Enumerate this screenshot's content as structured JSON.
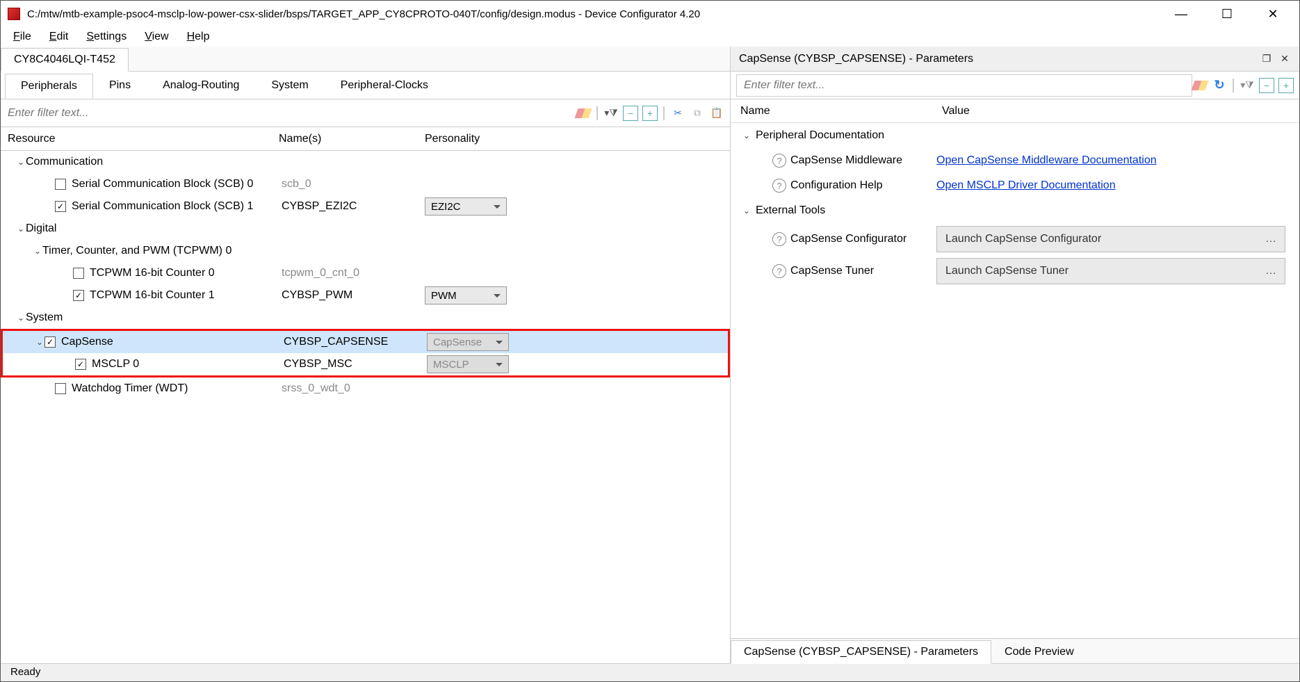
{
  "window": {
    "title": "C:/mtw/mtb-example-psoc4-msclp-low-power-csx-slider/bsps/TARGET_APP_CY8CPROTO-040T/config/design.modus - Device Configurator 4.20"
  },
  "menu": {
    "file": "File",
    "edit": "Edit",
    "settings": "Settings",
    "view": "View",
    "help": "Help"
  },
  "deviceTab": "CY8C4046LQI-T452",
  "subtabs": {
    "peripherals": "Peripherals",
    "pins": "Pins",
    "analog": "Analog-Routing",
    "system": "System",
    "pclocks": "Peripheral-Clocks"
  },
  "filter": {
    "placeholder": "Enter filter text..."
  },
  "cols": {
    "resource": "Resource",
    "names": "Name(s)",
    "personality": "Personality"
  },
  "tree": {
    "comm": "Communication",
    "scb0": "Serial Communication Block (SCB) 0",
    "scb0n": "scb_0",
    "scb1": "Serial Communication Block (SCB) 1",
    "scb1n": "CYBSP_EZI2C",
    "scb1p": "EZI2C",
    "digital": "Digital",
    "tcpwm": "Timer, Counter, and PWM (TCPWM) 0",
    "cnt0": "TCPWM 16-bit Counter 0",
    "cnt0n": "tcpwm_0_cnt_0",
    "cnt1": "TCPWM 16-bit Counter 1",
    "cnt1n": "CYBSP_PWM",
    "cnt1p": "PWM",
    "system": "System",
    "capsense": "CapSense",
    "capsensen": "CYBSP_CAPSENSE",
    "capsensep": "CapSense",
    "msclp": "MSCLP 0",
    "msclpn": "CYBSP_MSC",
    "msclpp": "MSCLP",
    "wdt": "Watchdog Timer (WDT)",
    "wdtn": "srss_0_wdt_0"
  },
  "panel": {
    "title": "CapSense (CYBSP_CAPSENSE) - Parameters",
    "filterPlaceholder": "Enter filter text...",
    "nameCol": "Name",
    "valueCol": "Value",
    "grpDoc": "Peripheral Documentation",
    "mwLabel": "CapSense Middleware",
    "mwLink": "Open CapSense Middleware Documentation",
    "chLabel": "Configuration Help",
    "chLink": "Open MSCLP Driver Documentation",
    "grpTools": "External Tools",
    "cfgLabel": "CapSense Configurator",
    "cfgBtn": "Launch CapSense Configurator",
    "tunLabel": "CapSense Tuner",
    "tunBtn": "Launch CapSense Tuner"
  },
  "bottomTabs": {
    "params": "CapSense (CYBSP_CAPSENSE) - Parameters",
    "code": "Code Preview"
  },
  "status": "Ready"
}
